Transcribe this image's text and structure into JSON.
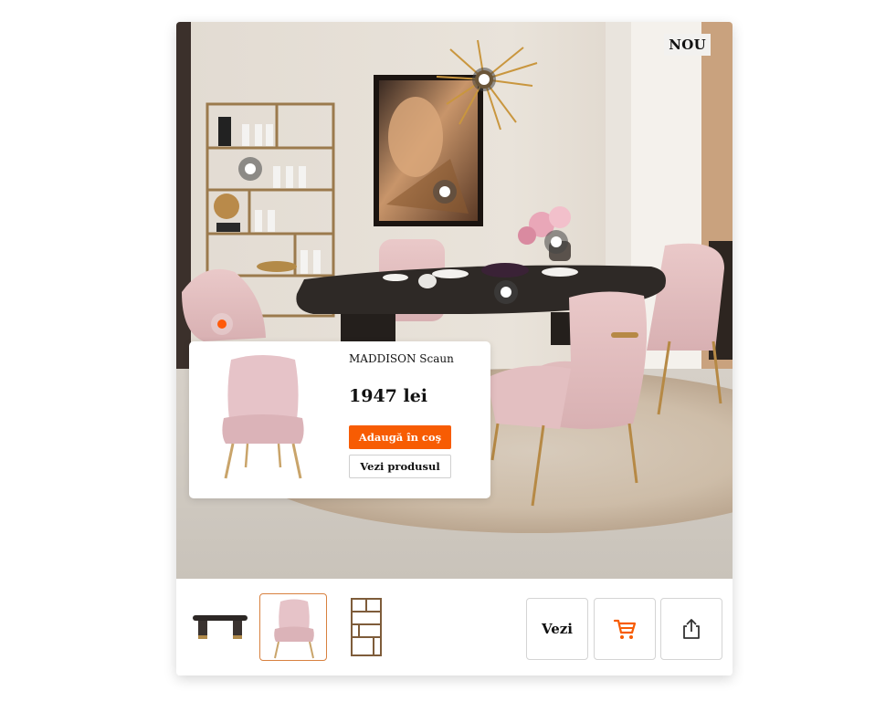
{
  "badge": {
    "label": "NOU"
  },
  "hotspots": [
    {
      "name": "hotspot-shelf",
      "active": false
    },
    {
      "name": "hotspot-painting",
      "active": false
    },
    {
      "name": "hotspot-chandelier",
      "active": false
    },
    {
      "name": "hotspot-flowers",
      "active": false
    },
    {
      "name": "hotspot-table",
      "active": false
    },
    {
      "name": "hotspot-chair",
      "active": true
    }
  ],
  "popup": {
    "product_name": "MADDISON Scaun",
    "price": "1947 lei",
    "add_to_cart_label": "Adaugă în coş",
    "view_product_label": "Vezi produsul"
  },
  "thumbnails": [
    {
      "name": "table-thumbnail",
      "selected": false
    },
    {
      "name": "chair-thumbnail",
      "selected": true
    },
    {
      "name": "shelf-thumbnail",
      "selected": false
    }
  ],
  "actions": {
    "view_label": "Vezi",
    "cart_icon": "cart-icon",
    "share_icon": "share-icon"
  },
  "colors": {
    "accent": "#f75c03",
    "selected_border": "#d8813f"
  }
}
